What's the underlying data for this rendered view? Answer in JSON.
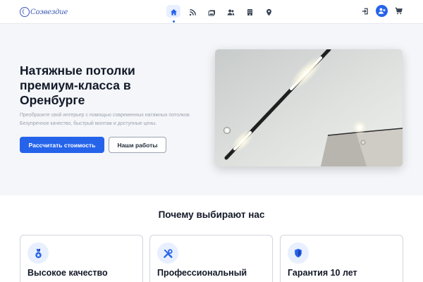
{
  "header": {
    "logo_text": "Созвездие",
    "nav": [
      {
        "icon": "home-icon",
        "active": true
      },
      {
        "icon": "rss-icon",
        "active": false
      },
      {
        "icon": "gallery-icon",
        "active": false
      },
      {
        "icon": "team-icon",
        "active": false
      },
      {
        "icon": "building-icon",
        "active": false
      },
      {
        "icon": "location-pin-icon",
        "active": false
      }
    ],
    "right_icons": [
      "login-icon",
      "user-add-icon",
      "cart-icon"
    ]
  },
  "hero": {
    "title": "Натяжные потолки премиум-класса в Оренбурге",
    "subtitle": "Преобразите свой интерьер с помощью современных натяжных потолков. Безупречное качество, быстрый монтаж и доступные цены.",
    "primary_button": "Рассчитать стоимость",
    "secondary_button": "Наши работы"
  },
  "features": {
    "title": "Почему выбирают нас",
    "cards": [
      {
        "icon": "medal-icon",
        "title": "Высокое качество"
      },
      {
        "icon": "tools-icon",
        "title": "Профессиональный монтаж"
      },
      {
        "icon": "shield-check-icon",
        "title": "Гарантия 10 лет"
      }
    ]
  },
  "colors": {
    "accent": "#2563eb",
    "hero_bg": "#f4f6f9",
    "icon_bg": "#e8efff"
  }
}
